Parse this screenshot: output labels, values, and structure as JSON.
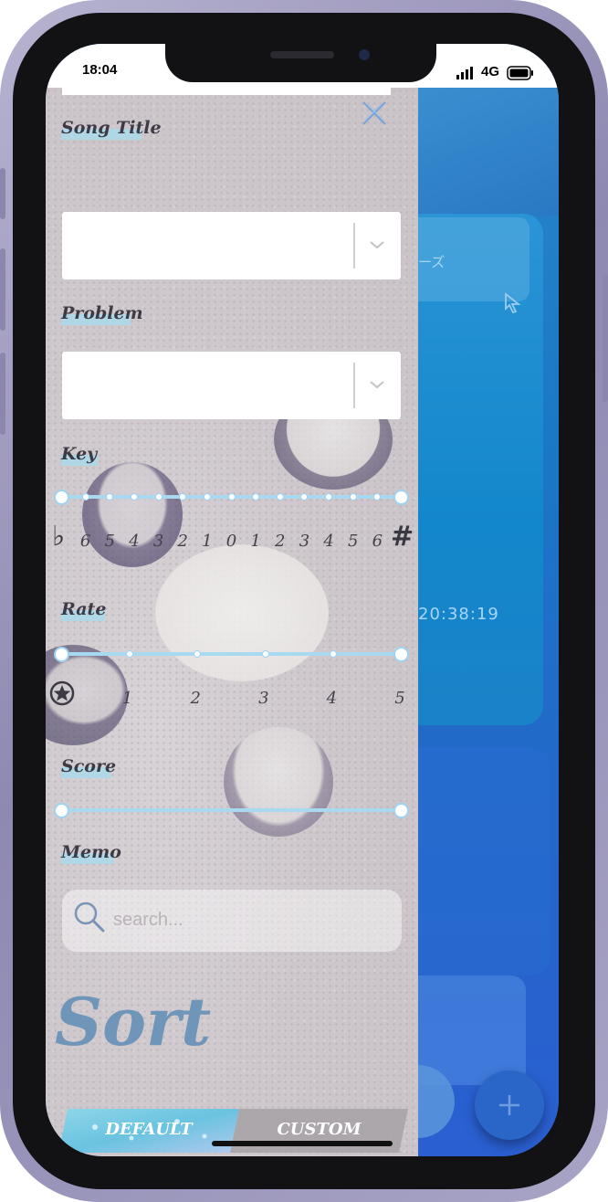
{
  "status_bar": {
    "time": "18:04",
    "network": "4G"
  },
  "drawer": {
    "song_title_label": "Song Title",
    "problem_label": "Problem",
    "key_label": "Key",
    "key_flat_symbol": "♭",
    "key_sharp_symbol": "#",
    "key_ticks": [
      "6",
      "5",
      "4",
      "3",
      "2",
      "1",
      "0",
      "1",
      "2",
      "3",
      "4",
      "5",
      "6"
    ],
    "rate_label": "Rate",
    "rate_ticks": [
      "1",
      "2",
      "3",
      "4",
      "5"
    ],
    "score_label": "Score",
    "memo_label": "Memo",
    "search_placeholder": "search...",
    "sort_title": "Sort",
    "sort_options": {
      "default": "DEFAULT",
      "custom": "CUSTOM"
    },
    "sort_selected": "DEFAULT"
  },
  "background_app": {
    "card_text_fragment": "ーズ",
    "time_text": "20:38:19"
  },
  "colors": {
    "accent": "#a9d9ea",
    "slider": "#9fd3ef",
    "sort_title": "#6f95b8"
  },
  "icons": [
    "close-icon",
    "chevron-down-icon",
    "star-icon",
    "search-icon",
    "cursor-icon",
    "plus-icon"
  ]
}
